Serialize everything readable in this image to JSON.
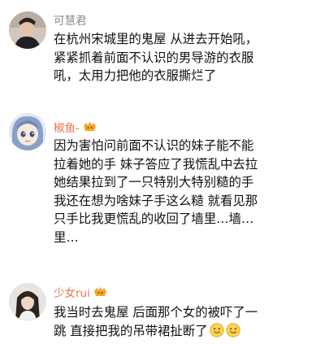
{
  "comments": [
    {
      "username": "可慧君",
      "has_badge": false,
      "lines": [
        "在杭州宋城里的鬼屋 从进去开始吼，",
        "紧紧抓着前面不认识的男导游的衣服",
        "吼，太用力把他的衣服撕烂了"
      ]
    },
    {
      "username": "椒鱼-",
      "has_badge": true,
      "lines": [
        "因为害怕问前面不认识的妹子能不能",
        "拉着她的手 妹子答应了我慌乱中去拉",
        "她结果拉到了一只特别大特别糙的手",
        "我还在想为啥妹子手这么糙 就看见那",
        "只手比我更慌乱的收回了墙里…墙…",
        "里…"
      ]
    },
    {
      "username": "少女rui",
      "has_badge": true,
      "lines": [
        "我当时去鬼屋 后面那个女的被吓了一",
        "跳 直接把我的吊带裙扯断了"
      ],
      "trailing_emoji": [
        "smile-emoji",
        "smile-emoji"
      ]
    }
  ],
  "colors": {
    "username_gray": "#888888",
    "username_orange": "#eb7350",
    "text": "#111111",
    "badge": "#f5a623"
  }
}
